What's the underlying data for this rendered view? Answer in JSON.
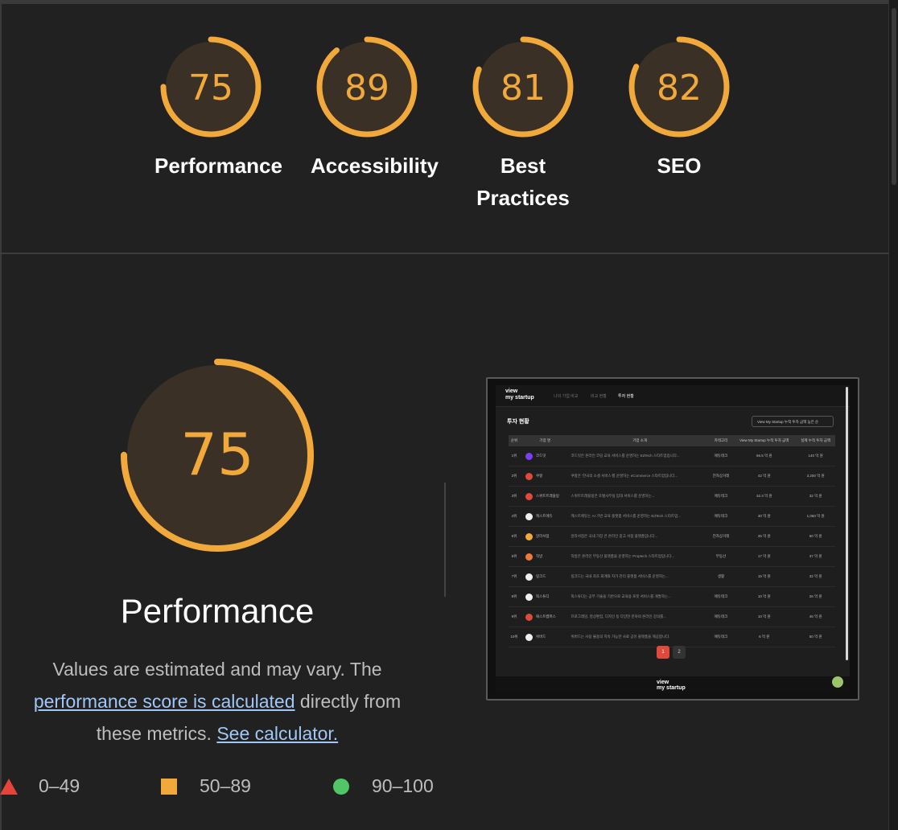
{
  "categories": [
    {
      "label": "Performance",
      "score": 75,
      "label_lines": [
        "Performance"
      ]
    },
    {
      "label": "Accessibility",
      "score": 89,
      "label_lines": [
        "Accessibility"
      ]
    },
    {
      "label": "Best Practices",
      "score": 81,
      "label_lines": [
        "Best",
        "Practices"
      ]
    },
    {
      "label": "SEO",
      "score": 82,
      "label_lines": [
        "SEO"
      ]
    }
  ],
  "detail": {
    "score": 75,
    "title": "Performance",
    "desc_before": "Values are estimated and may vary. The ",
    "desc_link": "performance score is calculated",
    "desc_middle": " directly from these metrics. ",
    "desc_calc_link": "See calculator."
  },
  "legend": {
    "fail": "0–49",
    "average": "50–89",
    "pass": "90–100"
  },
  "colors": {
    "average": "#f2a93b",
    "fail": "#e5443a",
    "pass": "#4fc765",
    "gauge_bg": "#3a3026"
  },
  "screenshot": {
    "logo_line1": "view",
    "logo_line2": "my startup",
    "nav": [
      "나의 기업 비교",
      "비교 현황",
      "투자 현황"
    ],
    "page_title": "투자 현황",
    "sort_label": "View My Startup 누적 투자 금액 높은 순",
    "columns": [
      "순위",
      "기업 명",
      "기업 소개",
      "카테고리",
      "View My Startup 누적 투자 금액",
      "실제 누적 투자 금액"
    ],
    "rows": [
      {
        "rank": "1위",
        "name": "코드잇",
        "desc": "코드잇은 온라인 코딩 교육 서비스를 운영하는 EdTech 스타트업입니다...",
        "cat": "에듀테크",
        "vms": "66.5 억 원",
        "real": "140 억 원",
        "color": "#7b3ff2"
      },
      {
        "rank": "2위",
        "name": "쿠팡",
        "desc": "쿠팡은 '한국의 소셜 서비스'를 운영하는 eCommerce 스타트업입니다...",
        "cat": "전자상거래",
        "vms": "42 억 원",
        "real": "3,200 억 원",
        "color": "#e04a3d"
      },
      {
        "rank": "3위",
        "name": "스위트트래블링",
        "desc": "스위트트래블링은 호텔사무실 임대 서비스를 운영하는...",
        "cat": "에듀테크",
        "vms": "32.3 억 원",
        "real": "32 억 원",
        "color": "#e04a3d"
      },
      {
        "rank": "4위",
        "name": "캐스트에듀",
        "desc": "캐스트에듀는 AI 기반 교육 플랫폼 서비스를 운영하는 EdTech 스타트업...",
        "cat": "에듀테크",
        "vms": "30 억 원",
        "real": "1,060 억 원",
        "color": "#f0f0f0"
      },
      {
        "rank": "5위",
        "name": "알라서점",
        "desc": "알라서점은 국내 가장 큰 온라인 중고 서점 플랫폼입니다...",
        "cat": "전자상거래",
        "vms": "25 억 원",
        "real": "60 억 원",
        "color": "#f2a93b"
      },
      {
        "rank": "6위",
        "name": "직방",
        "desc": "직방은 온라인 부동산 플랫폼을 운영하는 Proptech 스타트업입니다...",
        "cat": "부동산",
        "vms": "17 억 원",
        "real": "37 억 원",
        "color": "#f07a3a"
      },
      {
        "rank": "7위",
        "name": "링크드",
        "desc": "링크드는 국내 최초 회계와 자가 관리 플랫폼 서비스를 운영하는...",
        "cat": "생활",
        "vms": "15 억 원",
        "real": "32 억 원",
        "color": "#f0f0f0"
      },
      {
        "rank": "8위",
        "name": "픽스튜디",
        "desc": "픽스튜디는 공부 기술을 기반으로 교육용 로봇 서비스를 개발하는...",
        "cat": "에듀테크",
        "vms": "10 억 원",
        "real": "26 억 원",
        "color": "#f0f0f0"
      },
      {
        "rank": "9위",
        "name": "패스트캠퍼스",
        "desc": "프로그래밍, 영상편집, 디자인 등 다양한 분야의 온라인 강의를...",
        "cat": "에듀테크",
        "vms": "10 억 원",
        "real": "46 억 원",
        "color": "#e04a3d"
      },
      {
        "rank": "10위",
        "name": "위버드",
        "desc": "위버드는 사용 불용의 지속 가능한 사료 공유 플랫폼을 제공합니다.",
        "cat": "에듀테크",
        "vms": "6 억 원",
        "real": "50 억 원",
        "color": "#f0f0f0"
      }
    ],
    "pages": [
      "1",
      "2"
    ]
  }
}
